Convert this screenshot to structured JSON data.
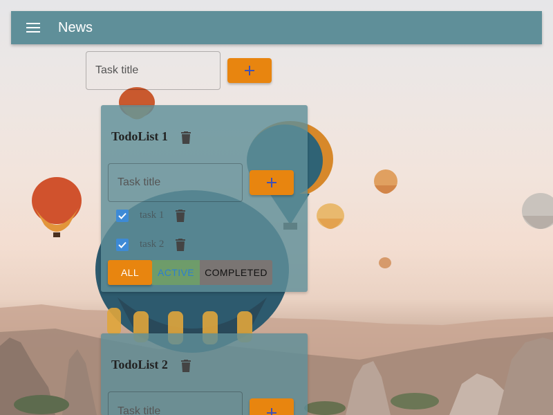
{
  "appbar": {
    "title": "News",
    "menu_icon": "menu-icon"
  },
  "new_list": {
    "placeholder": "Task title",
    "add_icon": "plus-icon"
  },
  "todolists": [
    {
      "title": "TodoList 1",
      "input_placeholder": "Task title",
      "tasks": [
        {
          "title": "task 1",
          "done": true
        },
        {
          "title": "task 2",
          "done": true
        }
      ],
      "filters": {
        "all": "ALL",
        "active": "ACTIVE",
        "completed": "COMPLETED",
        "selected": "all"
      }
    },
    {
      "title": "TodoList 2",
      "input_placeholder": "Task title"
    }
  ],
  "colors": {
    "appbar": "#5f8f99",
    "accent": "#e8850f",
    "card": "#5f8f99",
    "checkbox": "#3d8ad6",
    "plus_icon": "#3f51b5"
  }
}
